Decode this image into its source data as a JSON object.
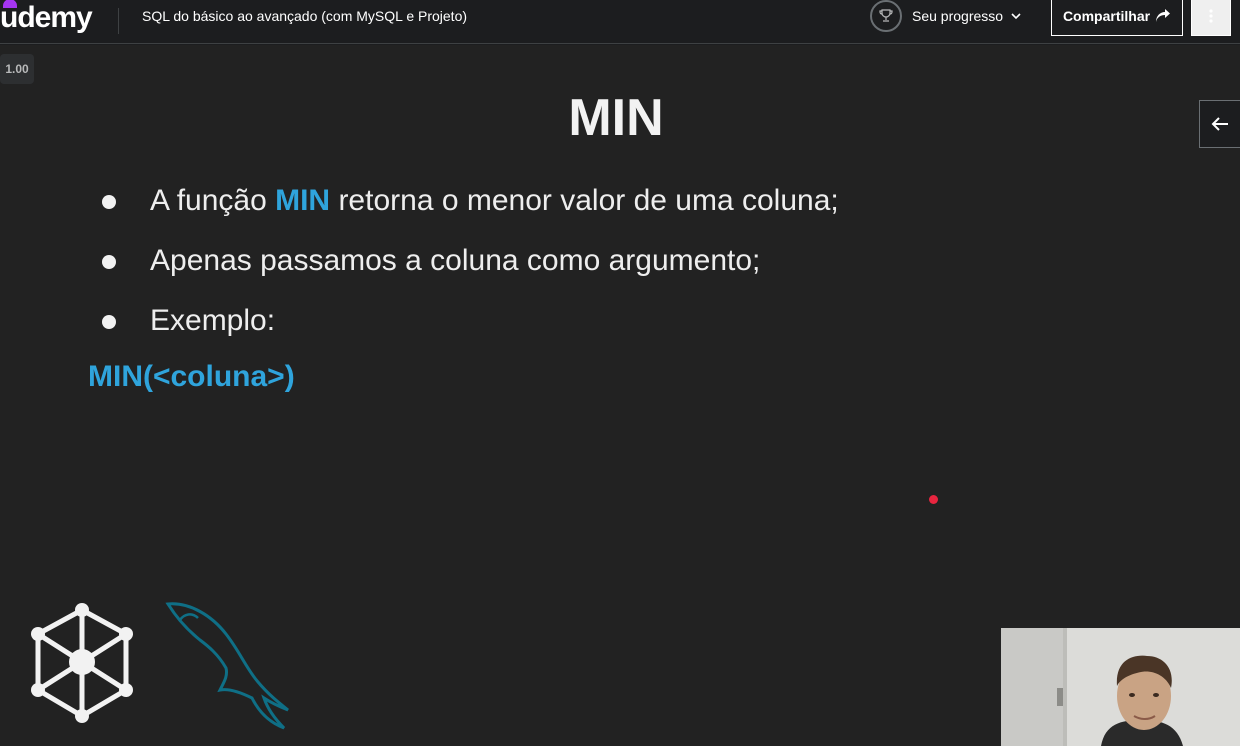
{
  "header": {
    "logo_text": "udemy",
    "course_title": "SQL do básico ao avançado (com MySQL e Projeto)",
    "progress_label": "Seu progresso",
    "share_label": "Compartilhar"
  },
  "player": {
    "speed": "1.00"
  },
  "slide": {
    "title": "MIN",
    "bullets": [
      {
        "pre": "A função ",
        "highlight": "MIN",
        "post": " retorna o menor valor de uma coluna;"
      },
      {
        "text": "Apenas passamos a coluna como argumento;"
      },
      {
        "text": "Exemplo:"
      }
    ],
    "syntax": "MIN(<coluna>)"
  },
  "icons": {
    "trophy": "trophy-icon",
    "chevron": "chevron-down-icon",
    "share": "share-arrow-icon",
    "more": "more-vertical-icon",
    "side": "arrow-left-icon"
  },
  "colors": {
    "brand_purple": "#a435f0",
    "highlight_blue": "#2fa4dc",
    "laser_red": "#e8253f"
  }
}
